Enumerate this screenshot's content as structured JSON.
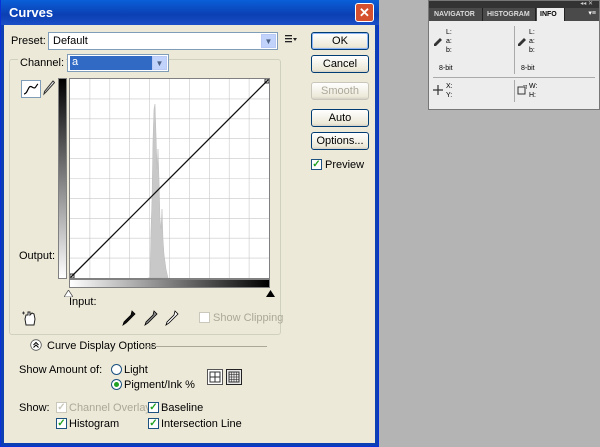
{
  "dialog": {
    "title": "Curves",
    "close_glyph": "✕",
    "preset_label": "Preset:",
    "preset_value": "Default",
    "channel_label": "Channel:",
    "channel_value": "a",
    "output_label": "Output:",
    "input_label": "Input:",
    "show_clipping_label": "Show Clipping",
    "buttons": {
      "ok": "OK",
      "cancel": "Cancel",
      "smooth": "Smooth",
      "auto": "Auto",
      "options": "Options..."
    },
    "preview_label": "Preview",
    "curve_display_options_label": "Curve Display Options",
    "show_amount_label": "Show Amount of:",
    "light_label": "Light",
    "pigment_label": "Pigment/Ink %",
    "show_label": "Show:",
    "channel_overlays_label": "Channel Overlays",
    "baseline_label": "Baseline",
    "histogram_label": "Histogram",
    "intersection_line_label": "Intersection Line",
    "checked": {
      "preview": true,
      "channel_overlays": true,
      "baseline": true,
      "histogram": true,
      "intersection_line": true,
      "show_clipping": false
    },
    "show_amount_selected": "Pigment/Ink %"
  },
  "info_panel": {
    "tabs": [
      "NAVIGATOR",
      "HISTOGRAM",
      "INFO"
    ],
    "active_tab": "INFO",
    "left_readout": [
      "L:",
      "a:",
      "b:"
    ],
    "right_readout": [
      "L:",
      "a:",
      "b:"
    ],
    "left_bit": "8-bit",
    "right_bit": "8-bit",
    "xy": [
      "X:",
      "Y:"
    ],
    "wh": [
      "W:",
      "H:"
    ]
  },
  "colors": {
    "title_bar": "#0b3fb3",
    "dialog_bg": "#ece9d8",
    "selection": "#316ac5",
    "check_green": "#21a121"
  },
  "icons": [
    "close-icon",
    "list-menu-icon",
    "curve-tool-icon",
    "pencil-icon",
    "hand-adjust-icon",
    "black-eyedropper-icon",
    "gray-eyedropper-icon",
    "white-eyedropper-icon",
    "collapse-icon",
    "simple-grid-icon",
    "detailed-grid-icon"
  ]
}
